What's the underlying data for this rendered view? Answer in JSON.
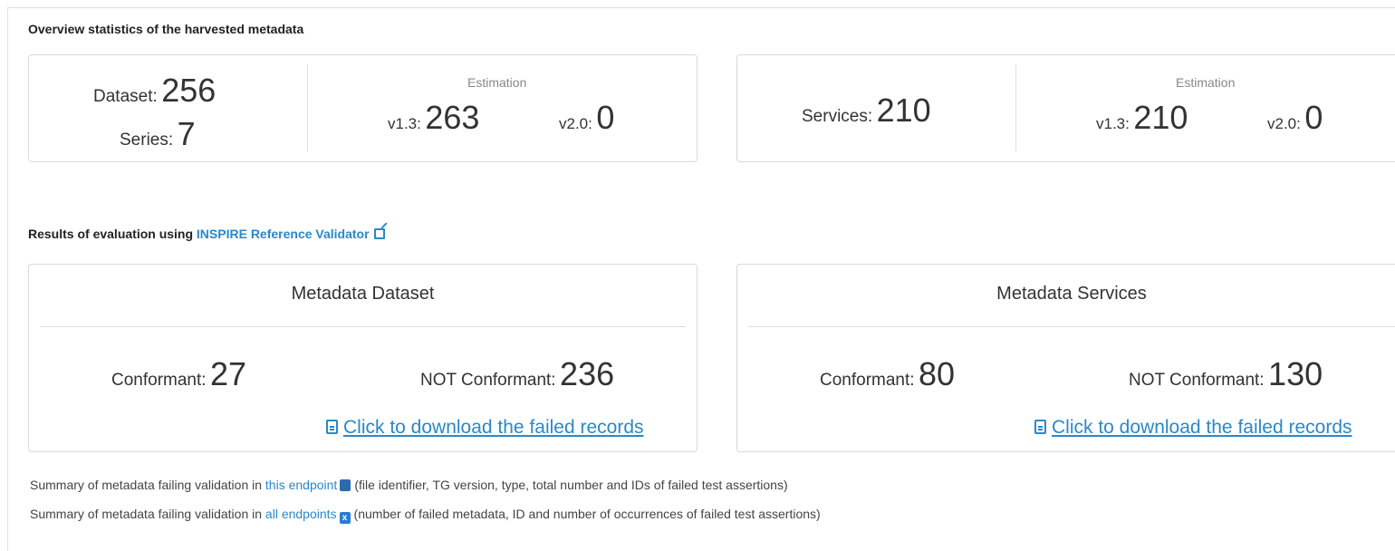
{
  "overview": {
    "title": "Overview statistics of the harvested metadata",
    "datasets_card": {
      "dataset_label": "Dataset:",
      "dataset_value": "256",
      "series_label": "Series:",
      "series_value": "7",
      "estimation_label": "Estimation",
      "v13_label": "v1.3:",
      "v13_value": "263",
      "v20_label": "v2.0:",
      "v20_value": "0"
    },
    "services_card": {
      "services_label": "Services:",
      "services_value": "210",
      "estimation_label": "Estimation",
      "v13_label": "v1.3:",
      "v13_value": "210",
      "v20_label": "v2.0:",
      "v20_value": "0"
    }
  },
  "evaluation": {
    "title_prefix": "Results of evaluation using",
    "validator_link": "INSPIRE Reference Validator",
    "dataset_card": {
      "heading": "Metadata Dataset",
      "conformant_label": "Conformant:",
      "conformant_value": "27",
      "not_conformant_label": "NOT Conformant:",
      "not_conformant_value": "236",
      "download_label": "Click to download the failed records"
    },
    "services_card": {
      "heading": "Metadata Services",
      "conformant_label": "Conformant:",
      "conformant_value": "80",
      "not_conformant_label": "NOT Conformant:",
      "not_conformant_value": "130",
      "download_label": "Click to download the failed records"
    }
  },
  "summary": {
    "line1_prefix": "Summary of metadata failing validation in",
    "line1_link": "this endpoint",
    "line1_suffix": "(file identifier, TG version, type, total number and IDs of failed test assertions)",
    "line2_prefix": "Summary of metadata failing validation in",
    "line2_link": "all endpoints",
    "line2_suffix": "(number of failed metadata, ID and number of occurrences of failed test assertions)"
  },
  "colors": {
    "link": "#2b88c8",
    "border": "#d9d9d9"
  },
  "icons": [
    "external-link-icon",
    "file-download-icon",
    "csv-file-icon",
    "excel-file-icon"
  ]
}
